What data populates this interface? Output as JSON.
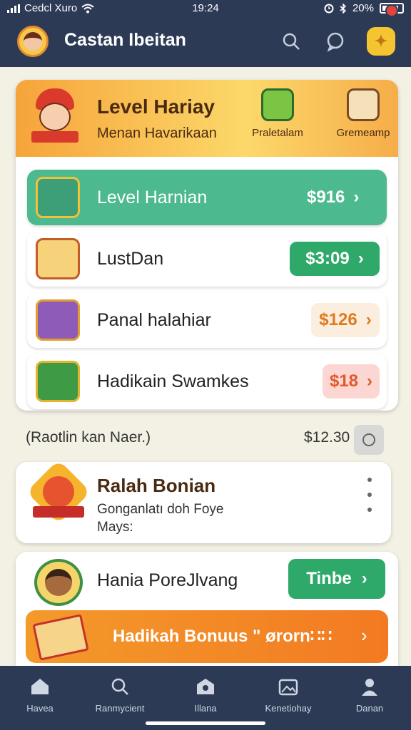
{
  "status_bar": {
    "carrier": "Cedcl Xuro",
    "time": "19:24",
    "battery": "20%"
  },
  "header": {
    "title": "Castan Ibeitan",
    "icons": [
      "avatar",
      "search-icon",
      "chat-icon",
      "coin-icon"
    ]
  },
  "banner": {
    "title": "Level Hariay",
    "subtitle": "Menan Havarikaan",
    "items": [
      {
        "label": "Praletalam",
        "icon": "house-coin-icon"
      },
      {
        "label": "Gremeamp",
        "icon": "gift-box-icon"
      }
    ]
  },
  "rows": [
    {
      "label": "Level Harnian",
      "price": "$916",
      "icon": "coin-stack-icon",
      "style": "highlight"
    },
    {
      "label": "LustDan",
      "price": "$3:09",
      "icon": "cards-icon",
      "style": "green-button"
    },
    {
      "label": "Panal halahiar",
      "price": "$126",
      "icon": "purple-chest-icon",
      "style": "soft"
    },
    {
      "label": "Hadikain Swamkes",
      "price": "$18",
      "icon": "green-badge-icon",
      "style": "pink"
    }
  ],
  "middle": {
    "text": "(Raotlin kan Naer.)",
    "amount": "$12.30"
  },
  "bonus_card": {
    "title": "Ralah Bonian",
    "description": "Gonganlatı doh Foye Mays:",
    "icon": "star-badge-icon"
  },
  "hero_row": {
    "label": "Hania PoreJlvang",
    "button": "Tinbe",
    "icon": "person-badge-icon"
  },
  "bonus_banner": {
    "text": "Hadikah Bonuus \" ørorn∷∷"
  },
  "nav": [
    {
      "label": "Havea",
      "icon": "home-icon"
    },
    {
      "label": "Ranmycient",
      "icon": "search-icon"
    },
    {
      "label": "Illana",
      "icon": "shop-icon"
    },
    {
      "label": "Kenetiohay",
      "icon": "photo-icon"
    },
    {
      "label": "Danan",
      "icon": "profile-icon"
    }
  ],
  "colors": {
    "header": "#2c3a55",
    "accent_orange": "#f6a43a",
    "teal": "#4cb98f",
    "green": "#2ea96a",
    "bonus": "#f37a22"
  }
}
